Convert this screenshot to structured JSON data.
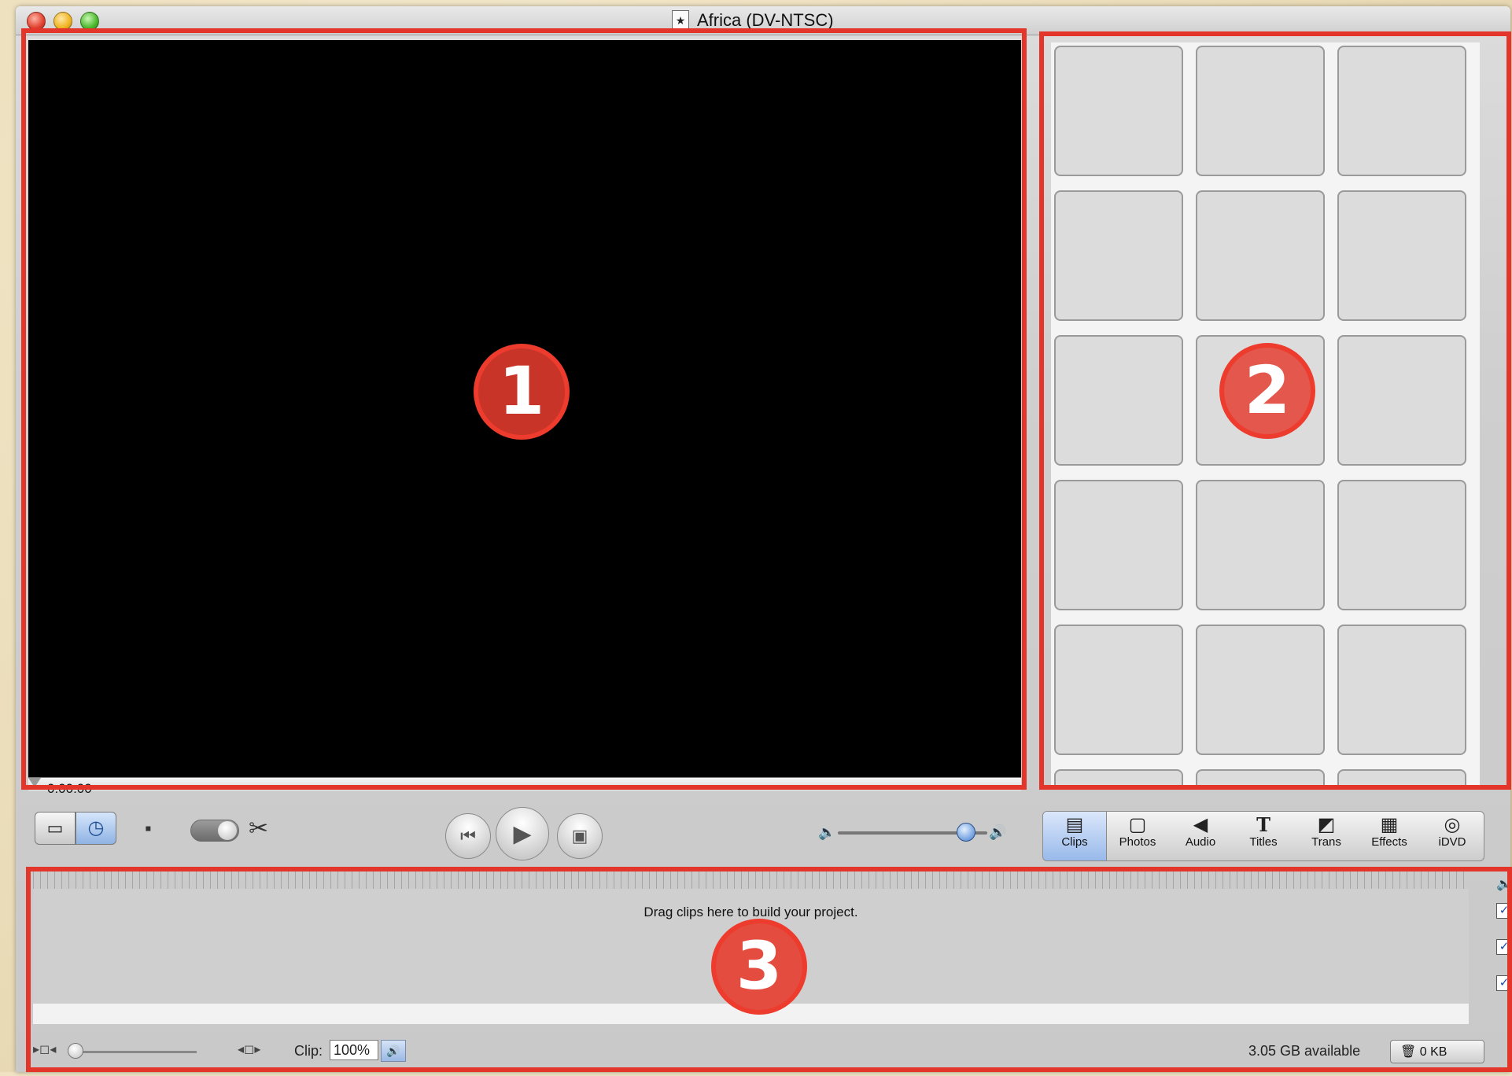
{
  "window": {
    "title": "Africa (DV-NTSC)"
  },
  "viewer": {
    "timecode": "0:00:00"
  },
  "controls": {
    "mode_clip_view": "▭",
    "mode_time_view": "◷",
    "camera_mode_icon": "▪",
    "scissors_icon": "✂",
    "rewind_icon": "⏮",
    "play_icon": "▶",
    "fullscreen_icon": "▣",
    "volume_low_icon": "🔈",
    "volume_high_icon": "🔊",
    "volume_level": 0.85
  },
  "panes": [
    {
      "label": "Clips",
      "icon": "▤",
      "active": true
    },
    {
      "label": "Photos",
      "icon": "▢",
      "active": false
    },
    {
      "label": "Audio",
      "icon": "◀",
      "active": false
    },
    {
      "label": "Titles",
      "icon": "T",
      "active": false
    },
    {
      "label": "Trans",
      "icon": "◩",
      "active": false
    },
    {
      "label": "Effects",
      "icon": "▦",
      "active": false
    },
    {
      "label": "iDVD",
      "icon": "◎",
      "active": false
    }
  ],
  "timeline": {
    "drag_message": "Drag clips here to build your project.",
    "clip_label": "Clip:",
    "clip_volume": "100%",
    "available": "3.05 GB available",
    "trash_label": "0 KB",
    "trash_icon": "🗑",
    "track_checked": [
      "✓",
      "✓",
      "✓"
    ]
  },
  "callouts": [
    "1",
    "2",
    "3"
  ],
  "colors": {
    "callout_red": "#e3352a",
    "viewer_bg": "#000000",
    "shelf_cell": "#dcdcdc"
  }
}
